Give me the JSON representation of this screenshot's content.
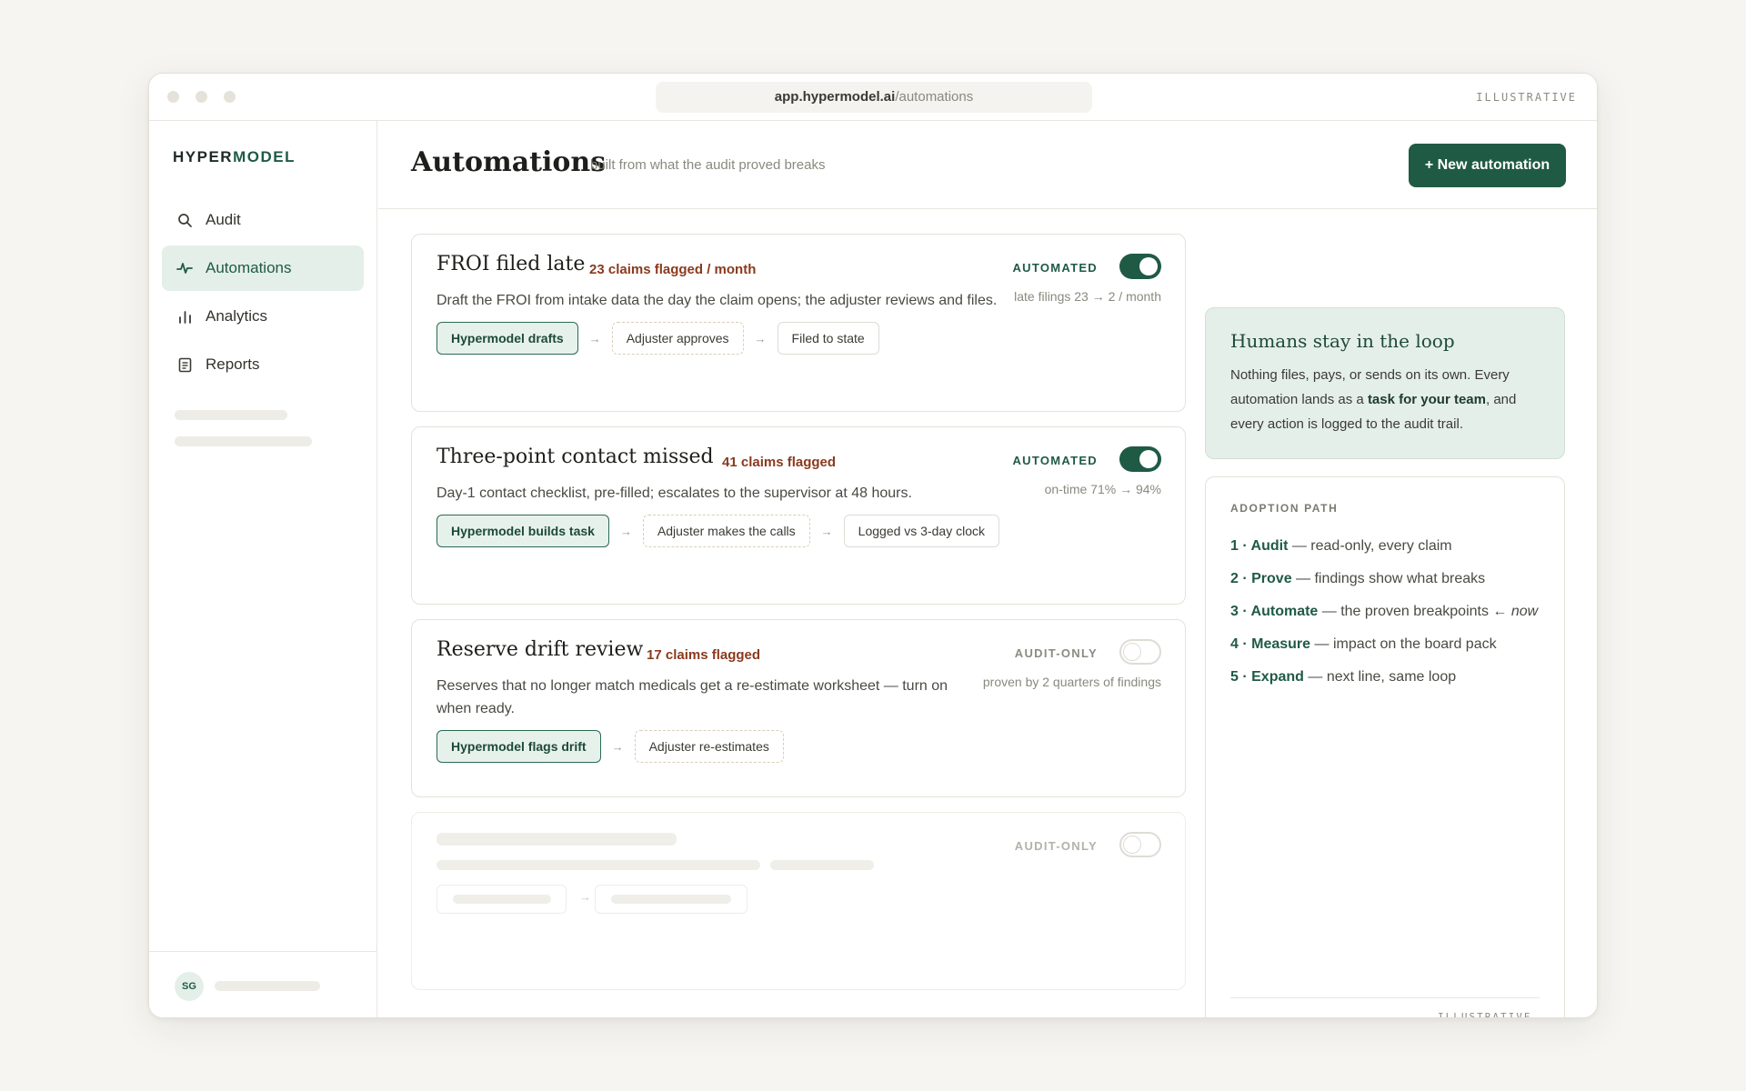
{
  "browser": {
    "url_host": "app.hypermodel.ai",
    "url_path": "/automations",
    "corner_label": "ILLUSTRATIVE"
  },
  "sidebar": {
    "logo_part1": "HYPER",
    "logo_part2": "MODEL",
    "items": [
      {
        "label": "Audit",
        "icon": "search-icon"
      },
      {
        "label": "Automations",
        "icon": "pulse-icon",
        "active": true
      },
      {
        "label": "Analytics",
        "icon": "bar-chart-icon"
      },
      {
        "label": "Reports",
        "icon": "document-icon"
      }
    ],
    "user_initials": "SG"
  },
  "header": {
    "title": "Automations",
    "subtitle": "built from what the audit proved breaks",
    "new_button": "+ New automation"
  },
  "cards": [
    {
      "title": "FROI filed late",
      "flag": "23 claims flagged / month",
      "status": "AUTOMATED",
      "toggle_on": true,
      "metric": "late filings 23 → 2 / month",
      "description": "Draft the FROI from intake data the day the claim opens; the adjuster reviews and files.",
      "steps": [
        "Hypermodel drafts",
        "Adjuster approves",
        "Filed to state"
      ]
    },
    {
      "title": "Three-point contact missed",
      "flag": "41 claims flagged",
      "status": "AUTOMATED",
      "toggle_on": true,
      "metric": "on-time 71% → 94%",
      "description": "Day-1 contact checklist, pre-filled; escalates to the supervisor at 48 hours.",
      "steps": [
        "Hypermodel builds task",
        "Adjuster makes the calls",
        "Logged vs 3-day clock"
      ]
    },
    {
      "title": "Reserve drift review",
      "flag": "17 claims flagged",
      "status": "AUDIT-ONLY",
      "toggle_on": false,
      "metric": "proven by 2 quarters of findings",
      "description_line1": "Reserves that no longer match medicals get a re-estimate worksheet — turn on",
      "description_line2": "when ready.",
      "steps": [
        "Hypermodel flags drift",
        "Adjuster re-estimates"
      ]
    },
    {
      "status": "AUDIT-ONLY",
      "toggle_on": false
    }
  ],
  "loop_panel": {
    "title": "Humans stay in the loop",
    "text_before": "Nothing files, pays, or sends on its own. Every automation lands as a ",
    "text_bold": "task for your team",
    "text_after": ", and every action is logged to the audit trail."
  },
  "adoption_path": {
    "heading": "ADOPTION PATH",
    "steps": [
      {
        "num": "1 · ",
        "name": "Audit",
        "desc": " — read-only, every claim",
        "suffix": ""
      },
      {
        "num": "2 · ",
        "name": "Prove",
        "desc": " — findings show what breaks",
        "suffix": ""
      },
      {
        "num": "3 · ",
        "name": "Automate",
        "desc": " — the proven breakpoints ← ",
        "suffix": "now"
      },
      {
        "num": "4 · ",
        "name": "Measure",
        "desc": " — impact on the board pack",
        "suffix": ""
      },
      {
        "num": "5 · ",
        "name": "Expand",
        "desc": " — next line, same loop",
        "suffix": ""
      }
    ],
    "footer_label": "ILLUSTRATIVE DATA"
  },
  "colors": {
    "accent": "#1f5a45",
    "flag": "#8a3a1e",
    "loop_bg": "#e5efea"
  }
}
